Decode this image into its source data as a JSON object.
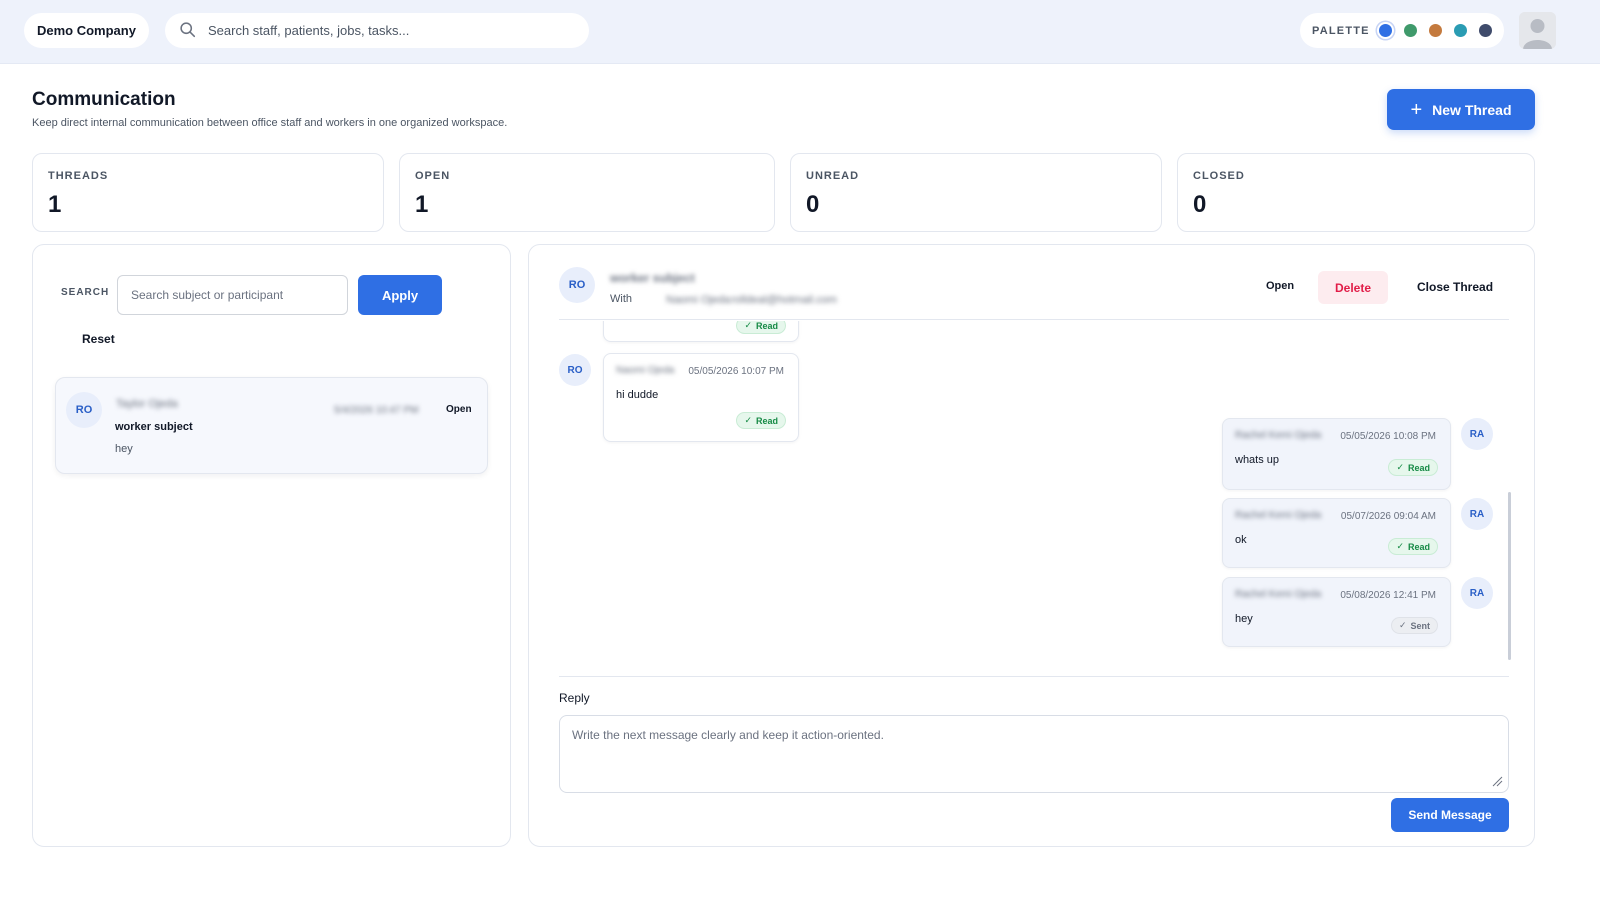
{
  "topbar": {
    "company": "Demo Company",
    "search_placeholder": "Search staff, patients, jobs, tasks...",
    "palette_label": "PALETTE",
    "palette_colors": [
      "#2f6fe4",
      "#3f9a6b",
      "#c47a3e",
      "#2a9cb3",
      "#3f4b6b"
    ],
    "avatar_icon": "user-avatar-icon"
  },
  "header": {
    "title": "Communication",
    "subtitle": "Keep direct internal communication between office staff and workers in one organized workspace.",
    "new_thread_label": "New Thread",
    "new_thread_icon": "plus-icon"
  },
  "stats": [
    {
      "label": "THREADS",
      "value": "1"
    },
    {
      "label": "OPEN",
      "value": "1"
    },
    {
      "label": "UNREAD",
      "value": "0"
    },
    {
      "label": "CLOSED",
      "value": "0"
    }
  ],
  "left_panel": {
    "search_label": "SEARCH",
    "search_placeholder": "Search subject or participant",
    "apply_label": "Apply",
    "reset_label": "Reset",
    "thread": {
      "avatar": "RO",
      "name": "Taylor Ojeda",
      "date": "5/4/2026 10:47 PM",
      "status": "Open",
      "subject": "worker subject",
      "preview": "hey"
    }
  },
  "conversation": {
    "avatar": "RO",
    "subject": "worker subject",
    "with_label": "With",
    "with_name": "Naomi Ojeda",
    "with_email": "rolldeal@hotmail.com",
    "status": "Open",
    "delete_label": "Delete",
    "close_label": "Close Thread",
    "messages": [
      {
        "avatar": "RO",
        "sender": "Naomi Ojeda",
        "time": "",
        "text": "",
        "status": "Read"
      },
      {
        "avatar": "RO",
        "sender": "Naomi Ojeda",
        "time": "05/05/2026 10:07 PM",
        "text": "hi dudde",
        "status": "Read"
      },
      {
        "avatar": "RA",
        "sender": "Rachel Kemi Ojeda",
        "time": "05/05/2026 10:08 PM",
        "text": "whats up",
        "status": "Read"
      },
      {
        "avatar": "RA",
        "sender": "Rachel Kemi Ojeda",
        "time": "05/07/2026 09:04 AM",
        "text": "ok",
        "status": "Read"
      },
      {
        "avatar": "RA",
        "sender": "Rachel Kemi Ojeda",
        "time": "05/08/2026 12:41 PM",
        "text": "hey",
        "status": "Sent"
      }
    ],
    "reply_label": "Reply",
    "reply_placeholder": "Write the next message clearly and keep it action-oriented.",
    "send_label": "Send Message"
  }
}
